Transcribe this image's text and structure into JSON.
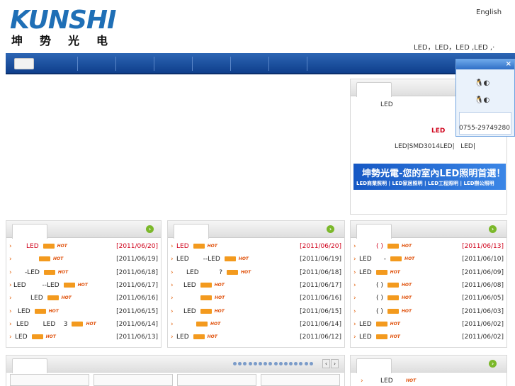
{
  "header": {
    "logo_latin": "KUNSHI",
    "logo_cn": "坤势光电",
    "lang_link": "English",
    "tagline": "LED，LED，LED ,LED ,·"
  },
  "intro": {
    "line1": "LED",
    "highlight": "LED",
    "line3": "LED|SMD3014LED|   LED|",
    "banner_title": "坤勢光電-您的室內LED照明首選！",
    "banner_sub": "LED商業照明 | LED家居照明 | LED工程照明 | LED辦公照明"
  },
  "qq": {
    "close": "×",
    "phone": "0755-29749280"
  },
  "news_left": [
    {
      "title": "LED",
      "date": "[2011/06/20]",
      "red": true
    },
    {
      "title": "",
      "date": "[2011/06/19]",
      "red": false
    },
    {
      "title": "-LED",
      "date": "[2011/06/18]",
      "red": false
    },
    {
      "title": "LED        --LED",
      "date": "[2011/06/17]",
      "red": false
    },
    {
      "title": "LED",
      "date": "[2011/06/16]",
      "red": false
    },
    {
      "title": "LED",
      "date": "[2011/06/15]",
      "red": false
    },
    {
      "title": "LED       LED    3",
      "date": "[2011/06/14]",
      "red": false
    },
    {
      "title": "LED",
      "date": "[2011/06/13]",
      "red": false
    }
  ],
  "news_middle": [
    {
      "title": "LED",
      "date": "[2011/06/20]",
      "red": true
    },
    {
      "title": "LED       --LED",
      "date": "[2011/06/19]",
      "red": false
    },
    {
      "title": "LED          ?",
      "date": "[2011/06/18]",
      "red": false
    },
    {
      "title": "LED",
      "date": "[2011/06/17]",
      "red": false
    },
    {
      "title": "",
      "date": "[2011/06/16]",
      "red": false
    },
    {
      "title": "LED",
      "date": "[2011/06/15]",
      "red": false
    },
    {
      "title": "",
      "date": "[2011/06/14]",
      "red": false
    },
    {
      "title": "LED",
      "date": "[2011/06/12]",
      "red": false
    }
  ],
  "news_right": [
    {
      "title": "( )",
      "date": "[2011/06/13]",
      "red": true
    },
    {
      "title": "LED      -",
      "date": "[2011/06/10]",
      "red": false
    },
    {
      "title": "LED",
      "date": "[2011/06/09]",
      "red": false
    },
    {
      "title": "( )",
      "date": "[2011/06/08]",
      "red": false
    },
    {
      "title": "( )",
      "date": "[2011/06/05]",
      "red": false
    },
    {
      "title": "( )",
      "date": "[2011/06/03]",
      "red": false
    },
    {
      "title": "LED",
      "date": "[2011/06/02]",
      "red": false
    },
    {
      "title": "LED",
      "date": "[2011/06/02]",
      "red": false
    }
  ],
  "bottom_right": {
    "item": "LED"
  }
}
